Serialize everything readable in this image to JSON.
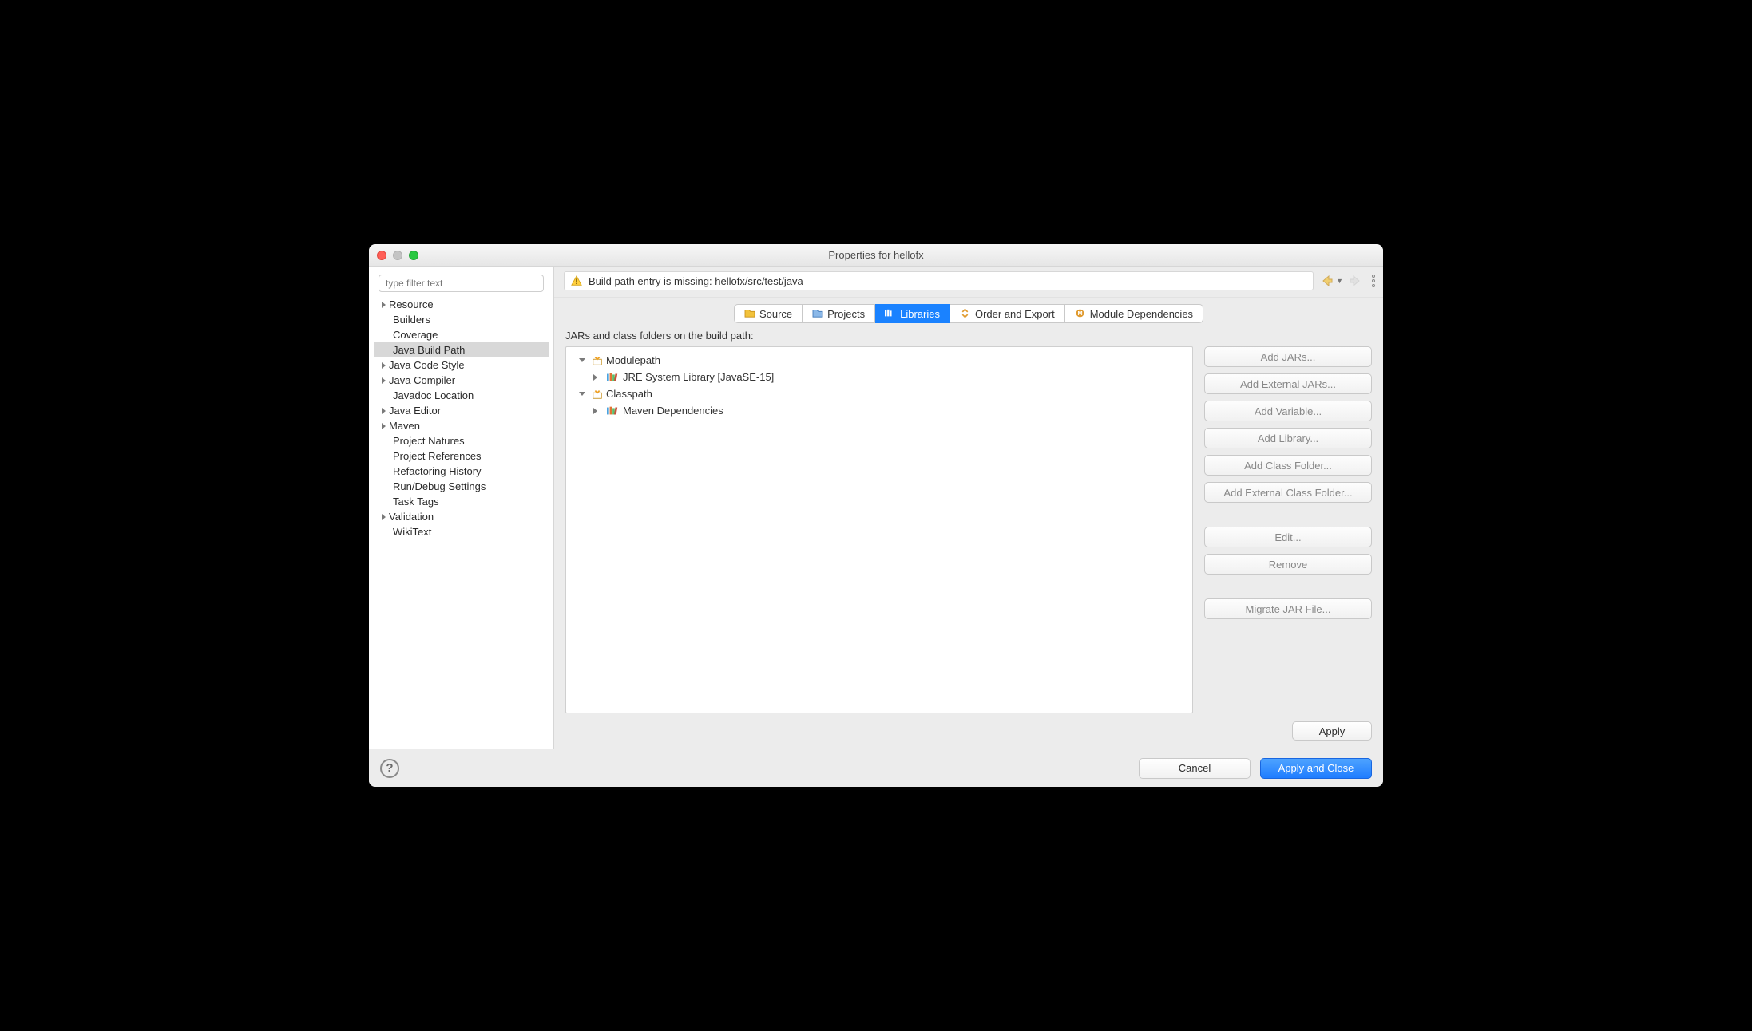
{
  "window": {
    "title": "Properties for hellofx"
  },
  "sidebar": {
    "filter_placeholder": "type filter text",
    "items": [
      {
        "label": "Resource",
        "expandable": true
      },
      {
        "label": "Builders",
        "expandable": false
      },
      {
        "label": "Coverage",
        "expandable": false
      },
      {
        "label": "Java Build Path",
        "expandable": false,
        "selected": true
      },
      {
        "label": "Java Code Style",
        "expandable": true
      },
      {
        "label": "Java Compiler",
        "expandable": true
      },
      {
        "label": "Javadoc Location",
        "expandable": false
      },
      {
        "label": "Java Editor",
        "expandable": true
      },
      {
        "label": "Maven",
        "expandable": true
      },
      {
        "label": "Project Natures",
        "expandable": false
      },
      {
        "label": "Project References",
        "expandable": false
      },
      {
        "label": "Refactoring History",
        "expandable": false
      },
      {
        "label": "Run/Debug Settings",
        "expandable": false
      },
      {
        "label": "Task Tags",
        "expandable": false
      },
      {
        "label": "Validation",
        "expandable": true
      },
      {
        "label": "WikiText",
        "expandable": false
      }
    ]
  },
  "message": "Build path entry is missing: hellofx/src/test/java",
  "tabs": [
    {
      "label": "Source"
    },
    {
      "label": "Projects"
    },
    {
      "label": "Libraries",
      "active": true
    },
    {
      "label": "Order and Export"
    },
    {
      "label": "Module Dependencies"
    }
  ],
  "main": {
    "heading": "JARs and class folders on the build path:",
    "tree": {
      "modulepath_label": "Modulepath",
      "jre_label": "JRE System Library [JavaSE-15]",
      "classpath_label": "Classpath",
      "maven_label": "Maven Dependencies"
    }
  },
  "buttons": {
    "add_jars": "Add JARs...",
    "add_ext_jars": "Add External JARs...",
    "add_var": "Add Variable...",
    "add_lib": "Add Library...",
    "add_cf": "Add Class Folder...",
    "add_ext_cf": "Add External Class Folder...",
    "edit": "Edit...",
    "remove": "Remove",
    "migrate": "Migrate JAR File..."
  },
  "apply": "Apply",
  "footer": {
    "cancel": "Cancel",
    "apply_close": "Apply and Close"
  }
}
